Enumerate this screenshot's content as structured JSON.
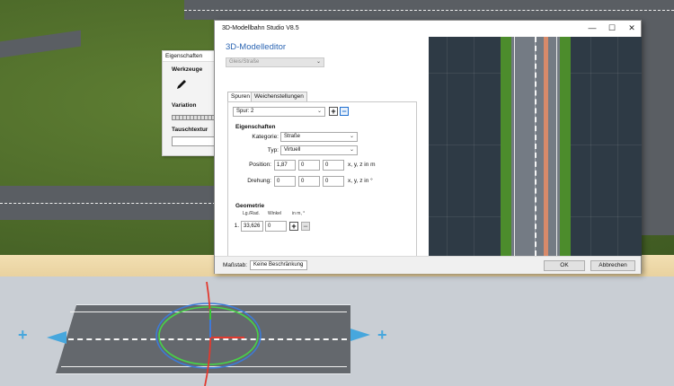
{
  "scene": {
    "properties_panel": {
      "title": "Eigenschaften",
      "tools_heading": "Werkzeuge",
      "tool_icon": "pencil-icon",
      "variation_heading": "Variation",
      "swap_texture_heading": "Tauschtextur"
    }
  },
  "dialog": {
    "title": "3D-Modellbahn Studio V8.5",
    "window_buttons": {
      "minimize": "—",
      "maximize": "☐",
      "close": "✕"
    },
    "heading": "3D-Modelleditor",
    "category_select": {
      "value": "Gleis/Straße"
    },
    "tabs": [
      {
        "label": "Spuren",
        "active": true
      },
      {
        "label": "Weichenstellungen",
        "active": false
      }
    ],
    "lanes": {
      "lane_select": {
        "value": "Spur: 2"
      },
      "add_button": "+",
      "remove_button": "−",
      "properties_heading": "Eigenschaften",
      "kategorie": {
        "label": "Kategorie:",
        "value": "Straße"
      },
      "typ": {
        "label": "Typ:",
        "value": "Virtuell"
      },
      "position": {
        "label": "Position:",
        "x": "1,87",
        "y": "0",
        "z": "0",
        "unit": "x, y, z in m"
      },
      "drehung": {
        "label": "Drehung:",
        "x": "0",
        "y": "0",
        "z": "0",
        "unit": "x, y, z in °"
      },
      "geometry_heading": "Geometrie",
      "geometry_cols": {
        "length": "Lg./Rad.",
        "angle": "Winkel",
        "units": "in m, °"
      },
      "geometry_rows": [
        {
          "index": "1.",
          "length": "33,626",
          "angle": "0"
        }
      ],
      "geometry_add": "+",
      "geometry_remove": "−"
    },
    "footer": {
      "scale_label": "Maßstab:",
      "scale_value": "Keine Beschränkung",
      "ok": "OK",
      "cancel": "Abbrechen"
    }
  }
}
